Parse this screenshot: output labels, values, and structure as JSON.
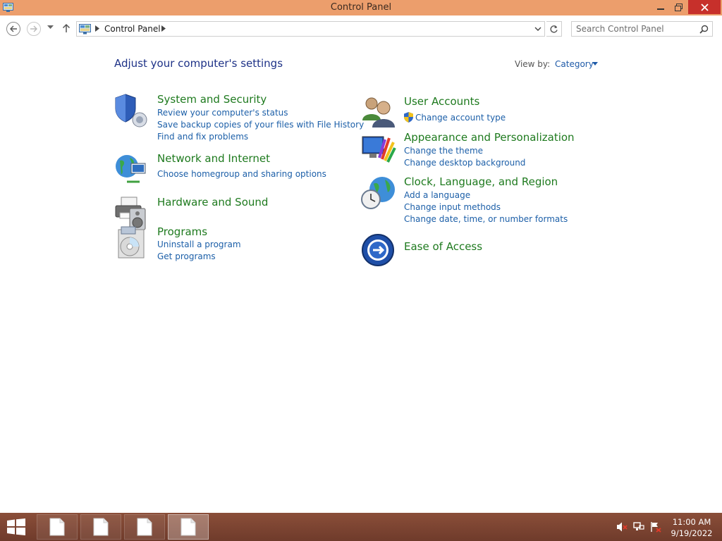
{
  "window": {
    "title": "Control Panel"
  },
  "address": {
    "crumb": "Control Panel"
  },
  "search": {
    "placeholder": "Search Control Panel"
  },
  "header": {
    "heading": "Adjust your computer's settings",
    "view_by_label": "View by:",
    "view_by_value": "Category"
  },
  "categories": [
    {
      "title": "System and Security",
      "icon": "shield-icon",
      "links": [
        "Review your computer's status",
        "Save backup copies of your files with File History",
        "Find and fix problems"
      ]
    },
    {
      "title": "Network and Internet",
      "icon": "network-globe-icon",
      "links": [
        "Choose homegroup and sharing options"
      ]
    },
    {
      "title": "Hardware and Sound",
      "icon": "printer-speaker-icon",
      "links": []
    },
    {
      "title": "Programs",
      "icon": "programs-disc-icon",
      "links": [
        "Uninstall a program",
        "Get programs"
      ]
    },
    {
      "title": "User Accounts",
      "icon": "users-icon",
      "links": [
        "Change account type"
      ]
    },
    {
      "title": "Appearance and Personalization",
      "icon": "monitor-palette-icon",
      "links": [
        "Change the theme",
        "Change desktop background"
      ]
    },
    {
      "title": "Clock, Language, and Region",
      "icon": "globe-clock-icon",
      "links": [
        "Add a language",
        "Change input methods",
        "Change date, time, or number formats"
      ]
    },
    {
      "title": "Ease of Access",
      "icon": "ease-of-access-icon",
      "links": []
    }
  ],
  "taskbar": {
    "time": "11:00 AM",
    "date": "9/19/2022"
  },
  "colors": {
    "titlebar": "#ec9e6c",
    "taskbar": "#7a4331",
    "close": "#c7302b",
    "category_title": "#1e7a1e",
    "link": "#1c5fa8",
    "heading": "#1e3287"
  }
}
